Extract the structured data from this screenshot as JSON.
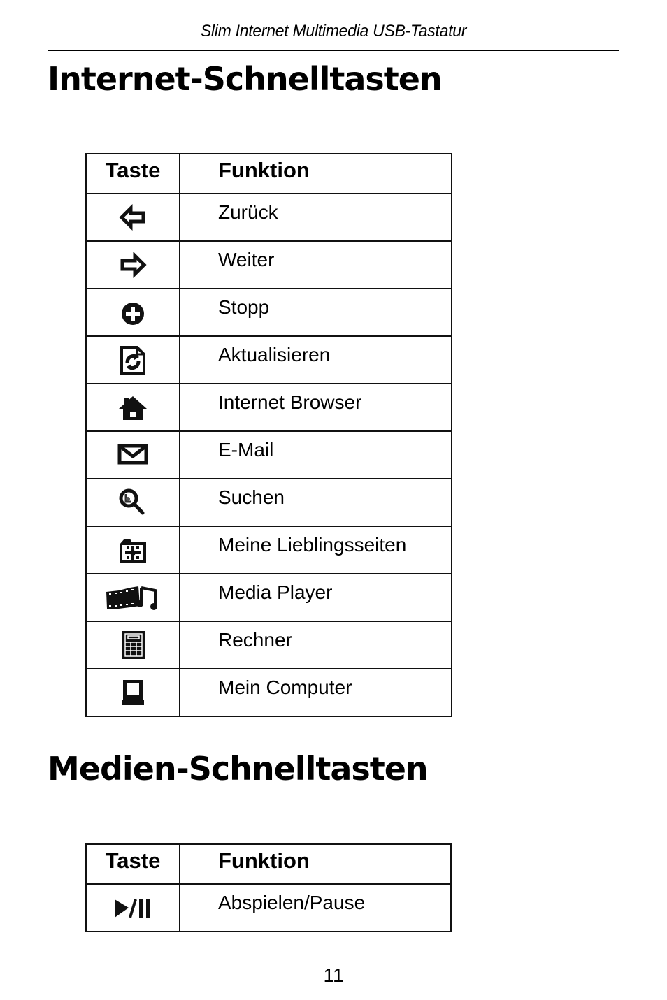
{
  "page": {
    "running_header": "Slim Internet Multimedia USB-Tastatur",
    "page_number": "11"
  },
  "internet_section": {
    "title": "Internet-Schnelltasten",
    "table": {
      "headers": {
        "key": "Taste",
        "function": "Funktion"
      },
      "rows": [
        {
          "icon": "back-arrow-icon",
          "function": "Zurück"
        },
        {
          "icon": "forward-arrow-icon",
          "function": "Weiter"
        },
        {
          "icon": "stop-icon",
          "function": "Stopp"
        },
        {
          "icon": "refresh-icon",
          "function": "Aktualisieren"
        },
        {
          "icon": "home-icon",
          "function": "Internet Browser"
        },
        {
          "icon": "mail-icon",
          "function": "E-Mail"
        },
        {
          "icon": "search-icon",
          "function": "Suchen"
        },
        {
          "icon": "favorites-folder-icon",
          "function": "Meine Lieblingsseiten"
        },
        {
          "icon": "media-player-icon",
          "function": "Media Player"
        },
        {
          "icon": "calculator-icon",
          "function": "Rechner"
        },
        {
          "icon": "my-computer-icon",
          "function": "Mein Computer"
        }
      ]
    }
  },
  "media_section": {
    "title": "Medien-Schnelltasten",
    "table": {
      "headers": {
        "key": "Taste",
        "function": "Funktion"
      },
      "rows": [
        {
          "icon": "play-pause-icon",
          "function": "Abspielen/Pause"
        }
      ]
    }
  }
}
